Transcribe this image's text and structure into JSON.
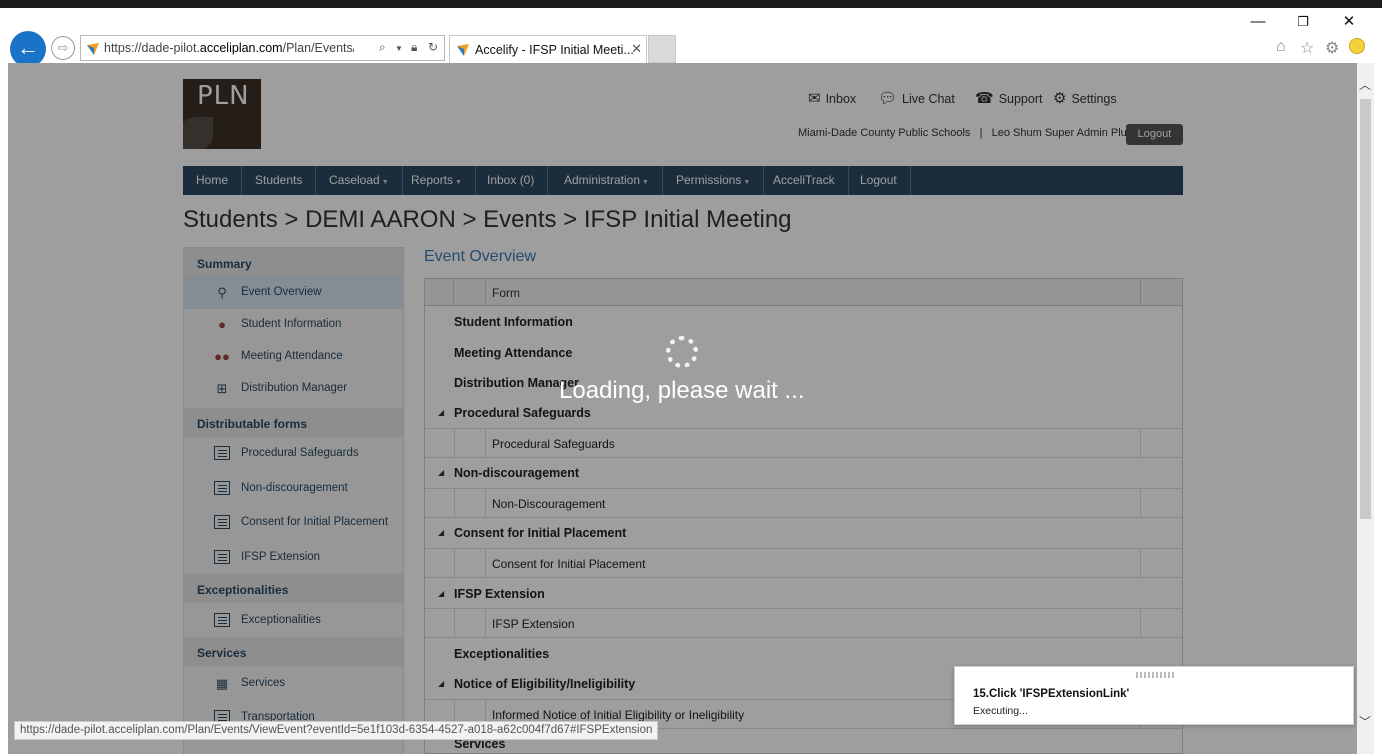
{
  "browser": {
    "url_prefix": "https://dade-pilot.",
    "url_domain": "acceliplan.com",
    "url_path": "/Plan/Events/Viev",
    "tab_title": "Accelify - IFSP Initial Meeti...",
    "window_controls": {
      "minimize": "—",
      "restore": "❐",
      "close": "✕"
    }
  },
  "header": {
    "logo_text": "PLN",
    "links": [
      {
        "label": "Inbox",
        "icon": "envelope-icon"
      },
      {
        "label": "Live Chat",
        "icon": "chat-icon"
      },
      {
        "label": "Support",
        "icon": "support-icon"
      },
      {
        "label": "Settings",
        "icon": "gear-icon"
      }
    ],
    "district": "Miami-Dade County Public Schools",
    "separator": "|",
    "user": "Leo Shum Super Admin Plus",
    "logout_button": "Logout"
  },
  "nav": {
    "items": [
      {
        "label": "Home",
        "dropdown": false
      },
      {
        "label": "Students",
        "dropdown": false
      },
      {
        "label": "Caseload",
        "dropdown": true
      },
      {
        "label": "Reports",
        "dropdown": true
      },
      {
        "label": "Inbox (0)",
        "dropdown": false
      },
      {
        "label": "Administration",
        "dropdown": true
      },
      {
        "label": "Permissions",
        "dropdown": true
      },
      {
        "label": "AcceliTrack",
        "dropdown": false
      },
      {
        "label": "Logout",
        "dropdown": false
      }
    ]
  },
  "breadcrumb": "Students > DEMI AARON > Events > IFSP Initial Meeting",
  "sidebar": {
    "summary_heading": "Summary",
    "summary_items": [
      "Event Overview",
      "Student Information",
      "Meeting Attendance",
      "Distribution Manager"
    ],
    "distributable_heading": "Distributable forms",
    "distributable_items": [
      "Procedural Safeguards",
      "Non-discouragement",
      "Consent for Initial Placement",
      "IFSP Extension"
    ],
    "exceptionalities_heading": "Exceptionalities",
    "exceptionalities_items": [
      "Exceptionalities"
    ],
    "services_heading": "Services",
    "services_items": [
      "Services",
      "Transportation"
    ]
  },
  "main": {
    "title": "Event Overview",
    "column_form": "Form",
    "rows": [
      {
        "group": "Student Information",
        "expandable": false
      },
      {
        "group": "Meeting Attendance",
        "expandable": false
      },
      {
        "group": "Distribution Manager",
        "expandable": false
      },
      {
        "group": "Procedural Safeguards",
        "expandable": true,
        "child": "Procedural Safeguards"
      },
      {
        "group": "Non-discouragement",
        "expandable": true,
        "child": "Non-Discouragement"
      },
      {
        "group": "Consent for Initial Placement",
        "expandable": true,
        "child": "Consent for Initial Placement"
      },
      {
        "group": "IFSP Extension",
        "expandable": true,
        "child": "IFSP Extension"
      },
      {
        "group": "Exceptionalities",
        "expandable": false
      },
      {
        "group": "Notice of Eligibility/Ineligibility",
        "expandable": true,
        "child": "Informed Notice of Initial Eligibility or Ineligibility"
      },
      {
        "group": "Services",
        "expandable": false
      }
    ]
  },
  "overlay": {
    "loading_text": "Loading, please wait ..."
  },
  "status_bar": {
    "url": "https://dade-pilot.acceliplan.com/Plan/Events/ViewEvent?eventId=5e1f103d-6354-4527-a018-a62c004f7d67#IFSPExtension"
  },
  "toast": {
    "step": "15.Click 'IFSPExtensionLink'",
    "status": "Executing..."
  },
  "colors": {
    "nav_bg": "#2c4a63",
    "link_blue": "#3a7ab3",
    "logo_bg": "#3b2f27"
  }
}
